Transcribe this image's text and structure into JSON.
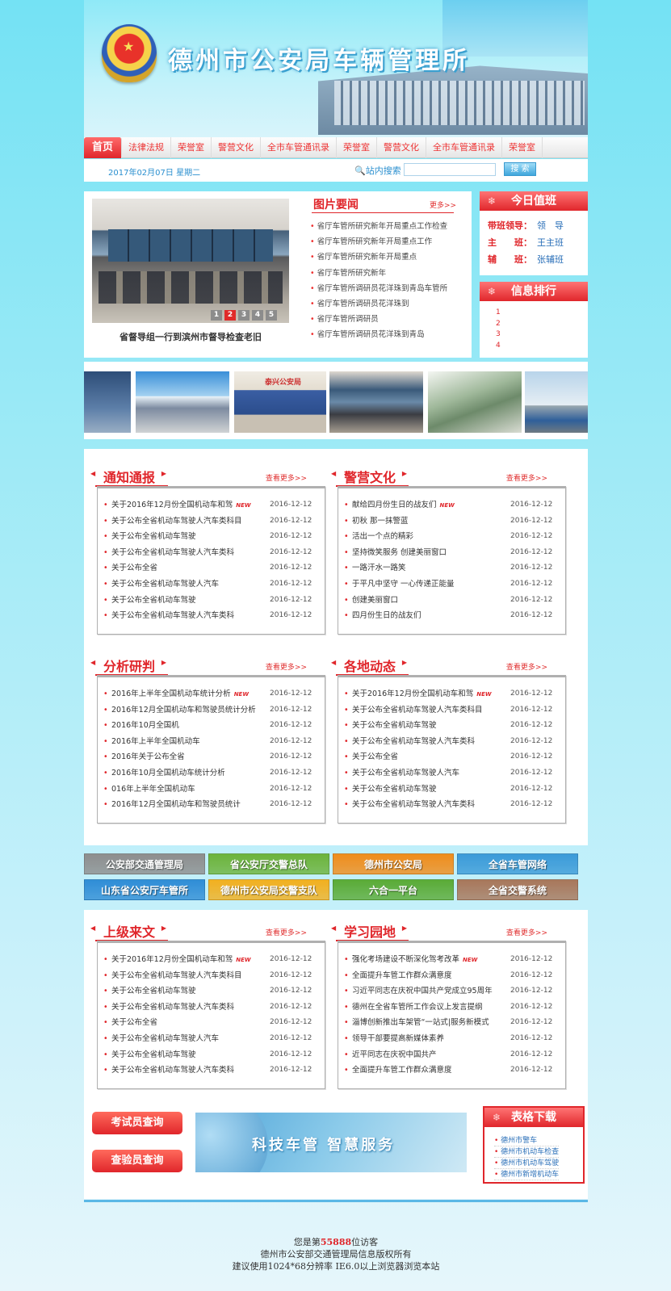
{
  "header": {
    "title": "德州市公安局车辆管理所"
  },
  "nav": [
    "首页",
    "法律法规",
    "荣誉室",
    "警营文化",
    "全市车管通讯录",
    "荣誉室",
    "警营文化",
    "全市车管通讯录",
    "荣誉室"
  ],
  "date": "2017年02月07日 星期二",
  "search": {
    "label": "站内搜索",
    "value": "",
    "button": "搜 索"
  },
  "focus": {
    "pages": [
      "1",
      "2",
      "3",
      "4",
      "5"
    ],
    "active_page": 2,
    "caption": "省督导组一行到滨州市督导检查老旧"
  },
  "picnews": {
    "title": "图片要闻",
    "more": "更多>>",
    "items": [
      "省厅车管所研究新年开局重点工作检查",
      "省厅车管所研究新年开局重点工作",
      "省厅车管所研究新年开局重点",
      "省厅车管所研究新年",
      "省厅车管所调研员花洋珠到青岛车管所",
      "省厅车管所调研员花洋珠到",
      "省厅车管所调研员",
      "省厅车管所调研员花洋珠到青岛"
    ]
  },
  "duty": {
    "title": "今日值班",
    "rows": [
      {
        "role": "带班领导：",
        "name": "领　导"
      },
      {
        "role": "主　　班：",
        "name": "王主班"
      },
      {
        "role": "辅　　班：",
        "name": "张辅班"
      }
    ]
  },
  "ranking": {
    "title": "信息排行",
    "items": [
      "1",
      "2",
      "3",
      "4"
    ]
  },
  "thumb_labels": {
    "t3": "泰兴公安局"
  },
  "columns": [
    {
      "title": "通知通报",
      "more": "查看更多>>",
      "items": [
        {
          "t": "关于2016年12月份全国机动车和驾",
          "d": "2016-12-12",
          "new": "NEW"
        },
        {
          "t": "关于公布全省机动车驾驶人汽车类科目",
          "d": "2016-12-12"
        },
        {
          "t": "关于公布全省机动车驾驶",
          "d": "2016-12-12"
        },
        {
          "t": "关于公布全省机动车驾驶人汽车类科",
          "d": "2016-12-12"
        },
        {
          "t": "关于公布全省",
          "d": "2016-12-12"
        },
        {
          "t": "关于公布全省机动车驾驶人汽车",
          "d": "2016-12-12"
        },
        {
          "t": "关于公布全省机动车驾驶",
          "d": "2016-12-12"
        },
        {
          "t": "关于公布全省机动车驾驶人汽车类科",
          "d": "2016-12-12"
        }
      ]
    },
    {
      "title": "警营文化",
      "more": "查看更多>>",
      "items": [
        {
          "t": "献给四月份生日的战友们",
          "d": "2016-12-12",
          "new": "NEW"
        },
        {
          "t": "初秋 那一抹警蓝",
          "d": "2016-12-12"
        },
        {
          "t": "活出一个点的精彩",
          "d": "2016-12-12"
        },
        {
          "t": "坚持微笑服务 创建美丽窗口",
          "d": "2016-12-12"
        },
        {
          "t": "一路汗水一路笑",
          "d": "2016-12-12"
        },
        {
          "t": "于平凡中坚守 一心传递正能量",
          "d": "2016-12-12"
        },
        {
          "t": "创建美丽窗口",
          "d": "2016-12-12"
        },
        {
          "t": "四月份生日的战友们",
          "d": "2016-12-12"
        }
      ]
    },
    {
      "title": "分析研判",
      "more": "查看更多>>",
      "items": [
        {
          "t": "2016年上半年全国机动车统计分析",
          "d": "2016-12-12",
          "new": "NEW"
        },
        {
          "t": "2016年12月全国机动车和驾驶员统计分析",
          "d": "2016-12-12"
        },
        {
          "t": "2016年10月全国机",
          "d": "2016-12-12"
        },
        {
          "t": "2016年上半年全国机动车",
          "d": "2016-12-12"
        },
        {
          "t": "2016年关于公布全省",
          "d": "2016-12-12"
        },
        {
          "t": "2016年10月全国机动车统计分析",
          "d": "2016-12-12"
        },
        {
          "t": "016年上半年全国机动车",
          "d": "2016-12-12"
        },
        {
          "t": "2016年12月全国机动车和驾驶员统计",
          "d": "2016-12-12"
        }
      ]
    },
    {
      "title": "各地动态",
      "more": "查看更多>>",
      "items": [
        {
          "t": "关于2016年12月份全国机动车和驾",
          "d": "2016-12-12",
          "new": "NEW"
        },
        {
          "t": "关于公布全省机动车驾驶人汽车类科目",
          "d": "2016-12-12"
        },
        {
          "t": "关于公布全省机动车驾驶",
          "d": "2016-12-12"
        },
        {
          "t": "关于公布全省机动车驾驶人汽车类科",
          "d": "2016-12-12"
        },
        {
          "t": "关于公布全省",
          "d": "2016-12-12"
        },
        {
          "t": "关于公布全省机动车驾驶人汽车",
          "d": "2016-12-12"
        },
        {
          "t": "关于公布全省机动车驾驶",
          "d": "2016-12-12"
        },
        {
          "t": "关于公布全省机动车驾驶人汽车类科",
          "d": "2016-12-12"
        }
      ]
    },
    {
      "title": "上级来文",
      "more": "查看更多>>",
      "items": [
        {
          "t": "关于2016年12月份全国机动车和驾",
          "d": "2016-12-12",
          "new": "NEW"
        },
        {
          "t": "关于公布全省机动车驾驶人汽车类科目",
          "d": "2016-12-12"
        },
        {
          "t": "关于公布全省机动车驾驶",
          "d": "2016-12-12"
        },
        {
          "t": "关于公布全省机动车驾驶人汽车类科",
          "d": "2016-12-12"
        },
        {
          "t": "关于公布全省",
          "d": "2016-12-12"
        },
        {
          "t": "关于公布全省机动车驾驶人汽车",
          "d": "2016-12-12"
        },
        {
          "t": "关于公布全省机动车驾驶",
          "d": "2016-12-12"
        },
        {
          "t": "关于公布全省机动车驾驶人汽车类科",
          "d": "2016-12-12"
        }
      ]
    },
    {
      "title": "学习园地",
      "more": "查看更多>>",
      "items": [
        {
          "t": "强化考场建设不断深化驾考改革",
          "d": "2016-12-12",
          "new": "NEW"
        },
        {
          "t": "全面提升车管工作群众满意度",
          "d": "2016-12-12"
        },
        {
          "t": "习近平同志在庆祝中国共产党成立95周年",
          "d": "2016-12-12"
        },
        {
          "t": "德州在全省车管所工作会议上发言提纲",
          "d": "2016-12-12"
        },
        {
          "t": "淄博创新推出车架管“一站式|服务新模式",
          "d": "2016-12-12"
        },
        {
          "t": "领导干部要提高新媒体素养",
          "d": "2016-12-12"
        },
        {
          "t": "近平同志在庆祝中国共产",
          "d": "2016-12-12"
        },
        {
          "t": "全面提升车管工作群众满意度",
          "d": "2016-12-12"
        }
      ]
    }
  ],
  "links": [
    {
      "label": "公安部交通管理局",
      "color": "#8d8d8d"
    },
    {
      "label": "省公安厅交警总队",
      "color": "#6cb33a"
    },
    {
      "label": "德州市公安局",
      "color": "#f08c1a"
    },
    {
      "label": "全省车管网络",
      "color": "#3a9ad8"
    },
    {
      "label": "山东省公安厅车管所",
      "color": "#2f8dd6"
    },
    {
      "label": "德州市公安局交警支队",
      "color": "#f2b01f"
    },
    {
      "label": "六合一平台",
      "color": "#5aab36"
    },
    {
      "label": "全省交警系统",
      "color": "#a8775a"
    }
  ],
  "query": {
    "examiner": "考试员查询",
    "inspector": "查验员查询"
  },
  "slogan": "科技车管 智慧服务",
  "download": {
    "title": "表格下载",
    "items": [
      "德州市警车",
      "德州市机动车检查",
      "德州市机动车驾驶",
      "德州市新增机动车"
    ]
  },
  "footer": {
    "visit_pre": "您是第",
    "visit_count": "55888",
    "visit_post": "位访客",
    "copyright": "德州市公安部交通管理局信息版权所有",
    "advice": "建议使用1024*68分辨率 IE6.0以上浏览器浏览本站"
  }
}
